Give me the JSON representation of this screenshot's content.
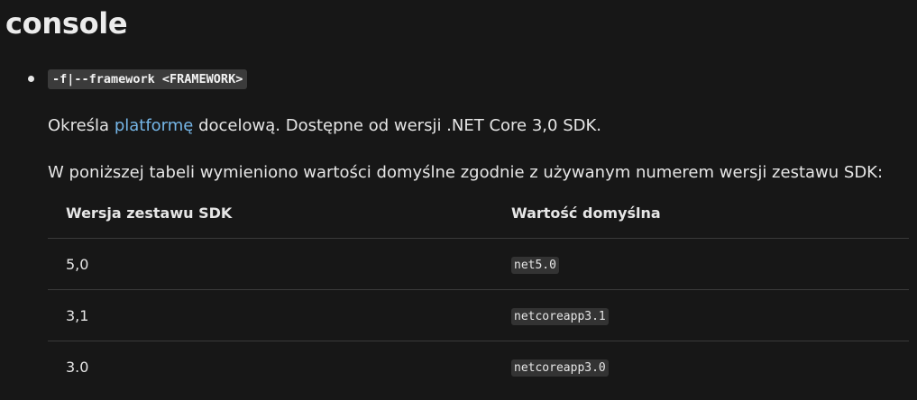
{
  "heading": "console",
  "option": {
    "code": "-f|--framework <FRAMEWORK>"
  },
  "para1": {
    "before": "Określa ",
    "link": "platformę",
    "after": " docelową. Dostępne od wersji .NET Core 3,0 SDK."
  },
  "para2": "W poniższej tabeli wymieniono wartości domyślne zgodnie z używanym numerem wersji zestawu SDK:",
  "table": {
    "headers": [
      "Wersja zestawu SDK",
      "Wartość domyślna"
    ],
    "rows": [
      {
        "version": "5,0",
        "value": "net5.0"
      },
      {
        "version": "3,1",
        "value": "netcoreapp3.1"
      },
      {
        "version": "3.0",
        "value": "netcoreapp3.0"
      }
    ]
  }
}
